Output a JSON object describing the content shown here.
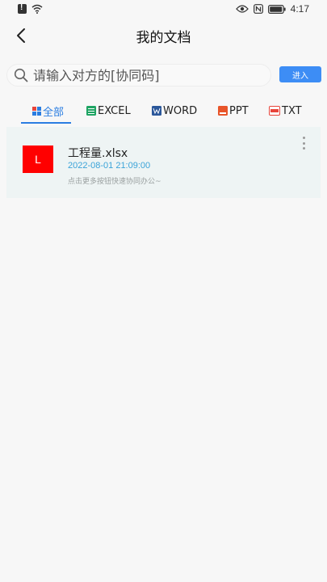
{
  "status_bar": {
    "time": "4:17",
    "icons": [
      "alert-icon",
      "wifi-icon",
      "eye-icon",
      "nfc-icon",
      "battery-icon"
    ]
  },
  "header": {
    "title": "我的文档",
    "back_icon": "chevron-left-icon"
  },
  "search": {
    "placeholder": "请输入对方的[协同码]",
    "value": "",
    "button_label": "进入"
  },
  "tabs": [
    {
      "label": "全部",
      "icon": "grid-icon",
      "active": true
    },
    {
      "label": "EXCEL",
      "icon": "excel-icon",
      "active": false
    },
    {
      "label": "WORD",
      "icon": "word-icon",
      "active": false
    },
    {
      "label": "PPT",
      "icon": "ppt-icon",
      "active": false
    },
    {
      "label": "TXT",
      "icon": "txt-icon",
      "active": false
    }
  ],
  "files": [
    {
      "thumb_letter": "L",
      "name": "工程量.xlsx",
      "date": "2022-08-01 21:09:00",
      "hint": "点击更多按钮快速协同办公~"
    }
  ],
  "colors": {
    "accent": "#2a7de1",
    "button": "#3d8df5",
    "card_bg": "#eef4f4",
    "thumb": "#ff0000",
    "date": "#3aa3d8"
  }
}
